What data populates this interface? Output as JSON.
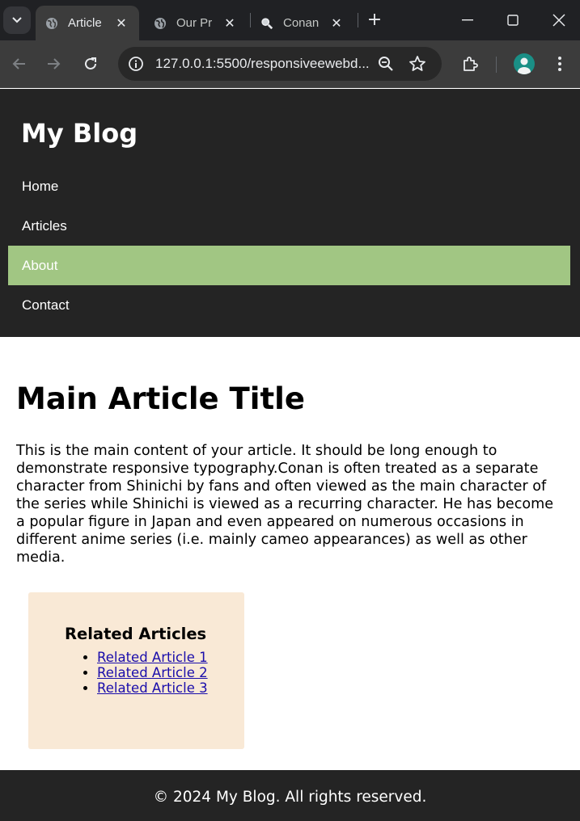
{
  "browser": {
    "tabs": [
      {
        "title": "Article",
        "favicon": "globe-icon",
        "active": true
      },
      {
        "title": "Our Pr",
        "favicon": "globe-icon",
        "active": false
      },
      {
        "title": "Conan",
        "favicon": "search-icon",
        "active": false
      }
    ],
    "new_tab_label": "+",
    "url": "127.0.0.1:5500/responsiveewebd...",
    "colors": {
      "tabstrip": "#202124",
      "toolbar": "#3c3c3c",
      "omnibox": "#282828",
      "avatar": "#1a8f86"
    }
  },
  "page": {
    "site_title": "My Blog",
    "nav": [
      {
        "label": "Home",
        "active": false
      },
      {
        "label": "Articles",
        "active": false
      },
      {
        "label": "About",
        "active": true
      },
      {
        "label": "Contact",
        "active": false
      }
    ],
    "article": {
      "title": "Main Article Title",
      "body": "This is the main content of your article. It should be long enough to demonstrate responsive typography.Conan is often treated as a separate character from Shinichi by fans and often viewed as the main character of the series while Shinichi is viewed as a recurring character. He has become a popular figure in Japan and even appeared on numerous occasions in different anime series (i.e. mainly cameo appearances) as well as other media."
    },
    "related": {
      "heading": "Related Articles",
      "links": [
        "Related Article 1",
        "Related Article 2",
        "Related Article 3"
      ]
    },
    "footer": "© 2024 My Blog. All rights reserved.",
    "colors": {
      "header": "#242424",
      "nav_active": "#a1c683",
      "aside": "#f9e9d6",
      "link": "#1a0dab"
    }
  }
}
